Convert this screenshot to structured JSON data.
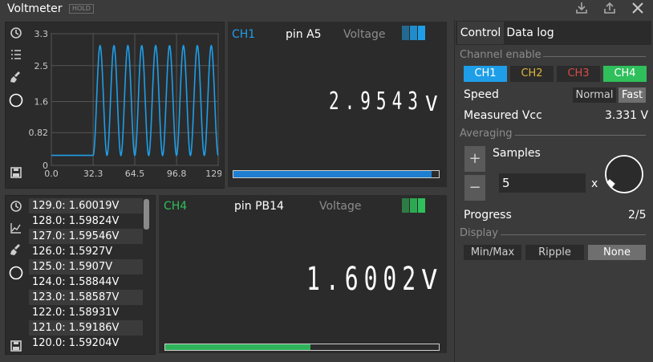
{
  "window": {
    "title": "Voltmeter",
    "hold_badge": "HOLD"
  },
  "titlebar_icons": [
    "download-icon",
    "export-icon",
    "close-icon"
  ],
  "chart": {
    "y_ticks": [
      "3.3",
      "2.5",
      "1.6",
      "0.82",
      "0"
    ],
    "x_ticks": [
      "0.0",
      "32.3",
      "64.5",
      "96.8",
      "129.0"
    ],
    "line_color": "#1e9ee8"
  },
  "chart_data": {
    "type": "line",
    "title": "",
    "xlabel": "",
    "ylabel": "",
    "xlim": [
      0,
      129.0
    ],
    "ylim": [
      0,
      3.3
    ],
    "x_ticks": [
      0.0,
      32.3,
      64.5,
      96.8,
      129.0
    ],
    "y_ticks": [
      0,
      0.82,
      1.6,
      2.5,
      3.3
    ],
    "series": [
      {
        "baseline_before": 0.25,
        "step_x": 32.3,
        "oscillation_min": 0.25,
        "oscillation_max": 3.0,
        "cycles": 9
      }
    ]
  },
  "meter1": {
    "channel": "CH1",
    "channel_color": "#1e9ee8",
    "pin": "pin A5",
    "mode": "Voltage",
    "value": "2.9543",
    "unit": "V",
    "progress": 0.965,
    "bar_color": "#1e7fd0"
  },
  "meter2": {
    "channel": "CH4",
    "channel_color": "#2fbf5b",
    "pin": "pin PB14",
    "mode": "Voltage",
    "value": "1.6002",
    "unit": "V",
    "progress": 0.53,
    "bar_color": "#2fb35a"
  },
  "log_list": [
    "129.0: 1.60019V",
    "128.0: 1.59824V",
    "127.0: 1.59546V",
    "126.0: 1.5927V",
    "125.0: 1.5907V",
    "124.0: 1.58844V",
    "123.0: 1.58587V",
    "122.0: 1.58931V",
    "121.0: 1.59186V",
    "120.0: 1.59204V"
  ],
  "tabs": [
    "Control",
    "Data log"
  ],
  "control": {
    "channel_enable_title": "Channel enable",
    "channels": [
      {
        "label": "CH1",
        "bg": "#1e9ee8",
        "fg": "#ffffff"
      },
      {
        "label": "CH2",
        "bg": "#2b2b2b",
        "fg": "#e0b43a"
      },
      {
        "label": "CH3",
        "bg": "#2b2b2b",
        "fg": "#d94a4a"
      },
      {
        "label": "CH4",
        "bg": "#2fbf5b",
        "fg": "#ffffff"
      }
    ],
    "speed_label": "Speed",
    "speed_options": [
      "Normal",
      "Fast"
    ],
    "vcc_label": "Measured Vcc",
    "vcc_value": "3.331 V",
    "averaging_title": "Averaging",
    "samples_label": "Samples",
    "samples_value": "5",
    "multiplier": "x",
    "progress_label": "Progress",
    "progress_value": "2/5",
    "display_title": "Display",
    "display_options": [
      "Min/Max",
      "Ripple",
      "None"
    ]
  }
}
